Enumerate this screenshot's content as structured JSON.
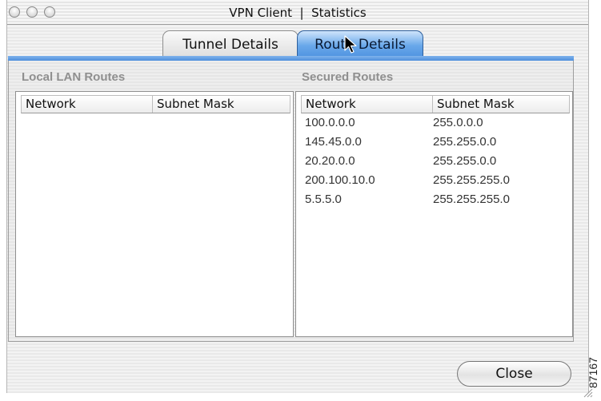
{
  "window": {
    "title": "VPN Client  |  Statistics"
  },
  "tabs": [
    {
      "label": "Tunnel Details",
      "active": false
    },
    {
      "label": "Route Details",
      "active": true
    }
  ],
  "local_lan_routes": {
    "label": "Local LAN Routes",
    "columns": [
      "Network",
      "Subnet Mask"
    ],
    "rows": []
  },
  "secured_routes": {
    "label": "Secured Routes",
    "columns": [
      "Network",
      "Subnet Mask"
    ],
    "rows": [
      {
        "network": "100.0.0.0",
        "mask": "255.0.0.0"
      },
      {
        "network": "145.45.0.0",
        "mask": "255.255.0.0"
      },
      {
        "network": "20.20.0.0",
        "mask": "255.255.0.0"
      },
      {
        "network": "200.100.10.0",
        "mask": "255.255.255.0"
      },
      {
        "network": "5.5.5.0",
        "mask": "255.255.255.0"
      }
    ]
  },
  "buttons": {
    "close_label": "Close"
  },
  "figure_number": "87167",
  "colors": {
    "active_tab": "#5a9ae4",
    "section_label": "#8f8f8f"
  }
}
